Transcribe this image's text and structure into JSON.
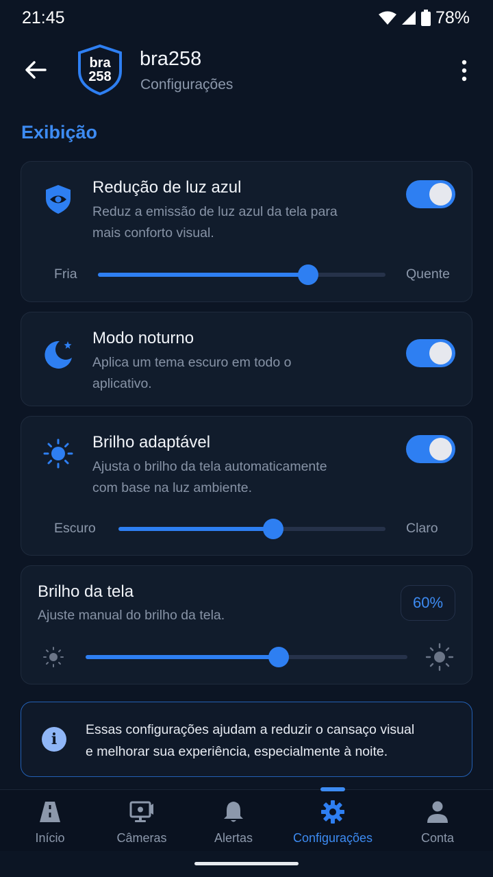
{
  "status_bar": {
    "time": "21:45",
    "battery": "78%"
  },
  "header": {
    "title": "bra258",
    "subtitle": "Configurações",
    "logo_line1": "bra",
    "logo_line2": "258"
  },
  "section": {
    "title": "Exibição"
  },
  "blue_light": {
    "title": "Redução de luz azul",
    "description": "Reduz a emissão de luz azul da tela para mais conforto visual.",
    "enabled": true,
    "slider_min_label": "Fria",
    "slider_max_label": "Quente",
    "slider_value": 0.73
  },
  "night_mode": {
    "title": "Modo noturno",
    "description": "Aplica um tema escuro em todo o aplicativo.",
    "enabled": true
  },
  "adaptive_brightness": {
    "title": "Brilho adaptável",
    "description": "Ajusta o brilho da tela automaticamente com base na luz ambiente.",
    "enabled": true,
    "slider_min_label": "Escuro",
    "slider_max_label": "Claro",
    "slider_value": 0.58
  },
  "screen_brightness": {
    "title": "Brilho da tela",
    "description": "Ajuste manual do brilho da tela.",
    "value_label": "60%",
    "slider_value": 0.6
  },
  "info": {
    "text_line1": "Essas configurações ajudam a reduzir o cansaço visual",
    "text_line2": "e melhorar sua experiência, especialmente à noite."
  },
  "bottom_nav": {
    "items": [
      {
        "label": "Início",
        "icon": "road-icon"
      },
      {
        "label": "Câmeras",
        "icon": "camera-icon"
      },
      {
        "label": "Alertas",
        "icon": "bell-icon"
      },
      {
        "label": "Configurações",
        "icon": "gear-icon",
        "active": true
      },
      {
        "label": "Conta",
        "icon": "person-icon"
      }
    ]
  },
  "colors": {
    "accent": "#2e7ff2",
    "background": "#0c1524",
    "card": "#111c2c"
  }
}
